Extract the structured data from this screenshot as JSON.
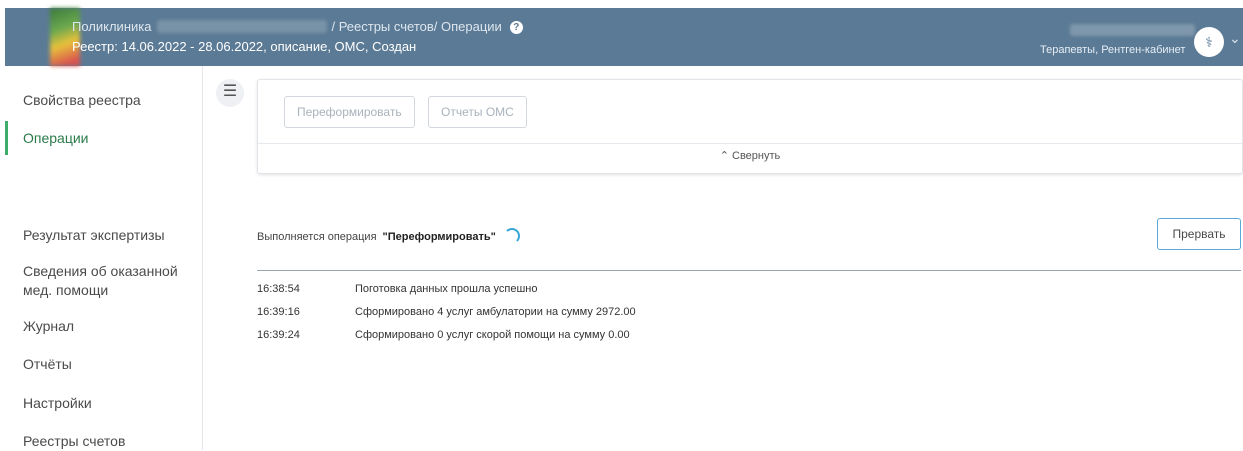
{
  "header": {
    "org": "Поликлиника",
    "breadcrumb": "/ Реестры счетов/ Операции",
    "registry_label": "Реестр:",
    "registry_value": "14.06.2022 - 28.06.2022, описание, ОМС, Создан",
    "department": "Терапевты, Рентген-кабинет",
    "help_glyph": "?",
    "avatar_glyph": "⚕",
    "colors": {
      "header_bg": "#5b7a95",
      "accent_green": "#3cad6b",
      "abort_border": "#5aa9d6"
    }
  },
  "sidebar": {
    "items": [
      {
        "label": "Свойства реестра",
        "active": false
      },
      {
        "label": "Операции",
        "active": true
      },
      {
        "label": "Результат экспертизы",
        "active": false
      },
      {
        "label": "Сведения об оказанной мед. помощи",
        "active": false
      },
      {
        "label": "Журнал",
        "active": false
      },
      {
        "label": "Отчёты",
        "active": false
      },
      {
        "label": "Настройки",
        "active": false
      },
      {
        "label": "Реестры счетов",
        "active": false
      }
    ]
  },
  "panel": {
    "reform_button": "Переформировать",
    "reports_button": "Отчеты ОМС",
    "collapse_label": "Свернуть"
  },
  "operation": {
    "prefix": "Выполняется операция",
    "name": "\"Переформировать\"",
    "abort_button": "Прервать"
  },
  "log": [
    {
      "time": "16:38:54",
      "message": "Поготовка данных прошла успешно"
    },
    {
      "time": "16:39:16",
      "message": "Сформировано 4 услуг амбулатории на сумму 2972.00"
    },
    {
      "time": "16:39:24",
      "message": "Сформировано 0 услуг скорой помощи на сумму 0.00"
    }
  ]
}
